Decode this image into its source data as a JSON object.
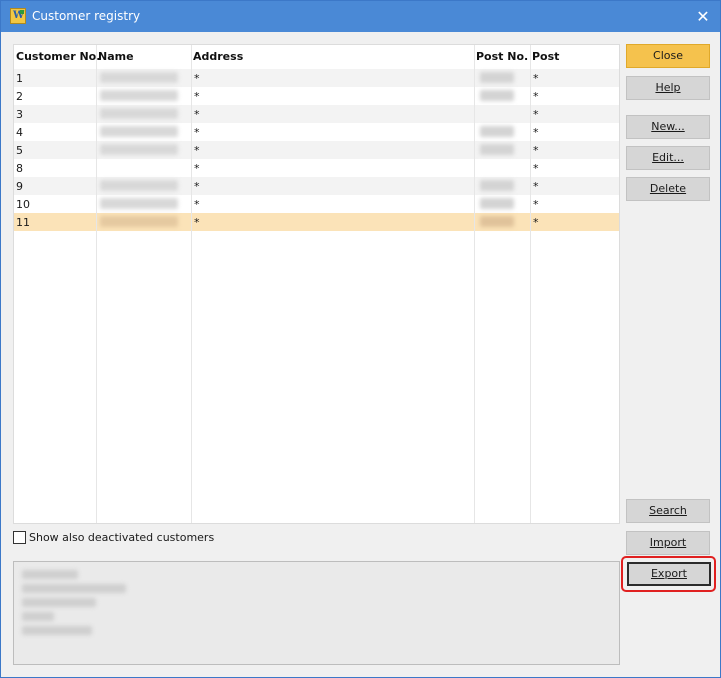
{
  "window": {
    "title": "Customer registry",
    "close_glyph": "✕",
    "app_icon": "w-app-icon",
    "icon_letter": "W"
  },
  "grid": {
    "columns": [
      "Customer No.",
      "Name",
      "Address",
      "Post No.",
      "Post"
    ],
    "rows": [
      {
        "no": "1",
        "address": "*",
        "post": "*"
      },
      {
        "no": "2",
        "address": "*",
        "post": "*"
      },
      {
        "no": "3",
        "address": "*",
        "post": "*"
      },
      {
        "no": "4",
        "address": "*",
        "post": "*"
      },
      {
        "no": "5",
        "address": "*",
        "post": "*"
      },
      {
        "no": "8",
        "address": "*",
        "post": "*"
      },
      {
        "no": "9",
        "address": "*",
        "post": "*"
      },
      {
        "no": "10",
        "address": "*",
        "post": "*"
      },
      {
        "no": "11",
        "address": "*",
        "post": "*"
      }
    ],
    "selected_row": "11"
  },
  "checkbox": {
    "label": "Show also deactivated customers",
    "checked": false
  },
  "buttons": {
    "close": "Close",
    "help": "Help",
    "new": "New...",
    "edit": "Edit...",
    "delete": "Delete",
    "search": "Search",
    "import": "Import",
    "export": "Export"
  },
  "colors": {
    "titlebar": "#4a89d6",
    "accent": "#f5c24d",
    "selection": "#fbe3b8",
    "highlight": "#e02020"
  }
}
